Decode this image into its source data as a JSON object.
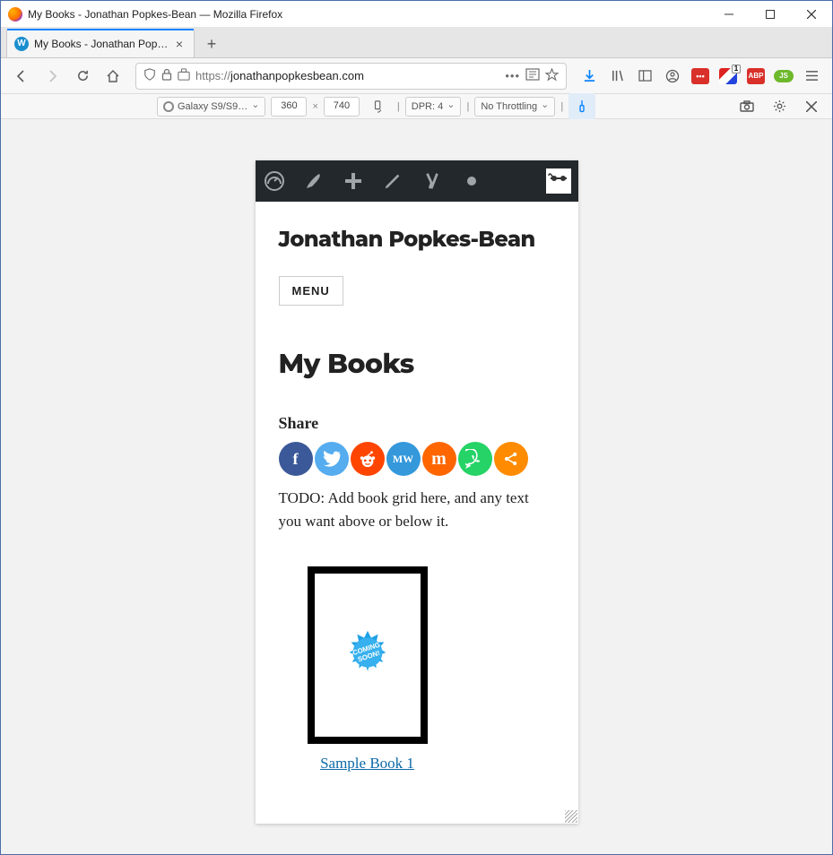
{
  "window": {
    "title": "My Books - Jonathan Popkes-Bean — Mozilla Firefox"
  },
  "tab": {
    "label": "My Books - Jonathan Popkes-B…"
  },
  "url": {
    "protocol": "https://",
    "domain": "jonathanpopkesbean.com"
  },
  "toolbar_badges": {
    "flag_count": "1",
    "abp_label": "ABP",
    "dots_label": "•••",
    "js_label": "JS"
  },
  "rdm": {
    "device": "Galaxy S9/S9…",
    "width": "360",
    "height": "740",
    "dpr_label": "DPR: 4",
    "throttle": "No Throttling"
  },
  "wp": {
    "site_title": "Jonathan Popkes-Bean",
    "menu_label": "MENU",
    "page_title": "My Books",
    "share_label": "Share",
    "body_text": "TODO: Add book grid here, and any text you want above or below it.",
    "book_link": "Sample Book 1",
    "coming_soon": "COMING SOON!"
  },
  "share": {
    "fb": "f",
    "tw": "",
    "rd": "",
    "mw": "MW",
    "mx": "m",
    "wa": "",
    "mo": ""
  }
}
